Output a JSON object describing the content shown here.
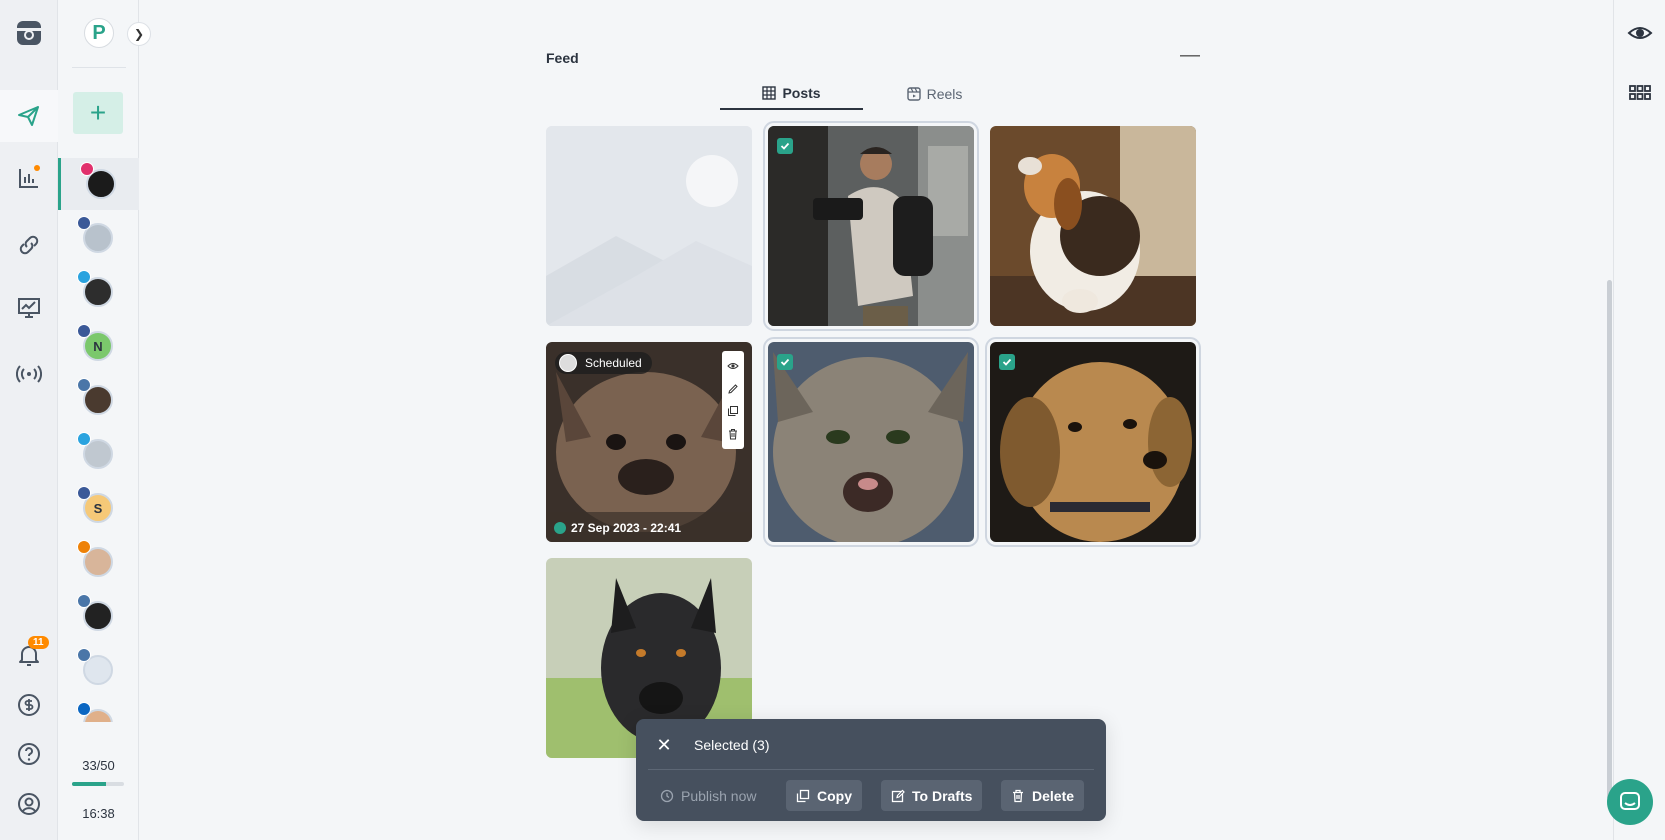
{
  "accounts": {
    "header_initial": "P",
    "items": [
      {
        "net": "instagram",
        "net_color": "#e1306c",
        "initial": "",
        "avatar_bg": "#1b1b1b",
        "selected": true
      },
      {
        "net": "facebook",
        "net_color": "#3b5998",
        "initial": "",
        "avatar_bg": "#b8c2cc"
      },
      {
        "net": "telegram",
        "net_color": "#2aa3df",
        "initial": "",
        "avatar_bg": "#2d2d2d"
      },
      {
        "net": "facebook",
        "net_color": "#3b5998",
        "initial": "N",
        "avatar_bg": "#7bc86c"
      },
      {
        "net": "vk",
        "net_color": "#4a76a8",
        "initial": "",
        "avatar_bg": "#4a3a2f"
      },
      {
        "net": "telegram",
        "net_color": "#2aa3df",
        "initial": "",
        "avatar_bg": "#c0c8d0"
      },
      {
        "net": "facebook",
        "net_color": "#3b5998",
        "initial": "S",
        "avatar_bg": "#f6c978"
      },
      {
        "net": "odnoklassniki",
        "net_color": "#ee8208",
        "initial": "",
        "avatar_bg": "#d8b59a"
      },
      {
        "net": "vk",
        "net_color": "#4a76a8",
        "initial": "",
        "avatar_bg": "#222222"
      },
      {
        "net": "vk",
        "net_color": "#4a76a8",
        "initial": "",
        "avatar_bg": "#dfe6ee"
      },
      {
        "net": "linkedin",
        "net_color": "#0a66c2",
        "initial": "",
        "avatar_bg": "#e0b08a"
      }
    ],
    "usage": "33/50",
    "usage_fraction": 0.66,
    "time": "16:38"
  },
  "rail": {
    "notifications_count": "11"
  },
  "feed": {
    "title": "Feed",
    "tabs": [
      {
        "label": "Posts",
        "icon": "grid-icon",
        "active": true
      },
      {
        "label": "Reels",
        "icon": "reels-icon",
        "active": false
      }
    ],
    "tiles": [
      {
        "kind": "placeholder"
      },
      {
        "kind": "photo",
        "subject": "man-with-camera",
        "checked": true
      },
      {
        "kind": "photo",
        "subject": "beagle",
        "checked": false
      },
      {
        "kind": "photo",
        "subject": "french-bulldog",
        "checked": false,
        "status": "Scheduled",
        "date": "27 Sep 2023 - 22:41"
      },
      {
        "kind": "photo",
        "subject": "cat",
        "checked": true
      },
      {
        "kind": "photo",
        "subject": "golden-retriever",
        "checked": true
      },
      {
        "kind": "photo",
        "subject": "cane-corso",
        "checked": false
      }
    ]
  },
  "selection": {
    "label": "Selected (3)",
    "publish": "Publish now",
    "copy": "Copy",
    "drafts": "To Drafts",
    "delete": "Delete"
  },
  "colors": {
    "accent": "#2aa38a",
    "bar": "#46505e"
  }
}
